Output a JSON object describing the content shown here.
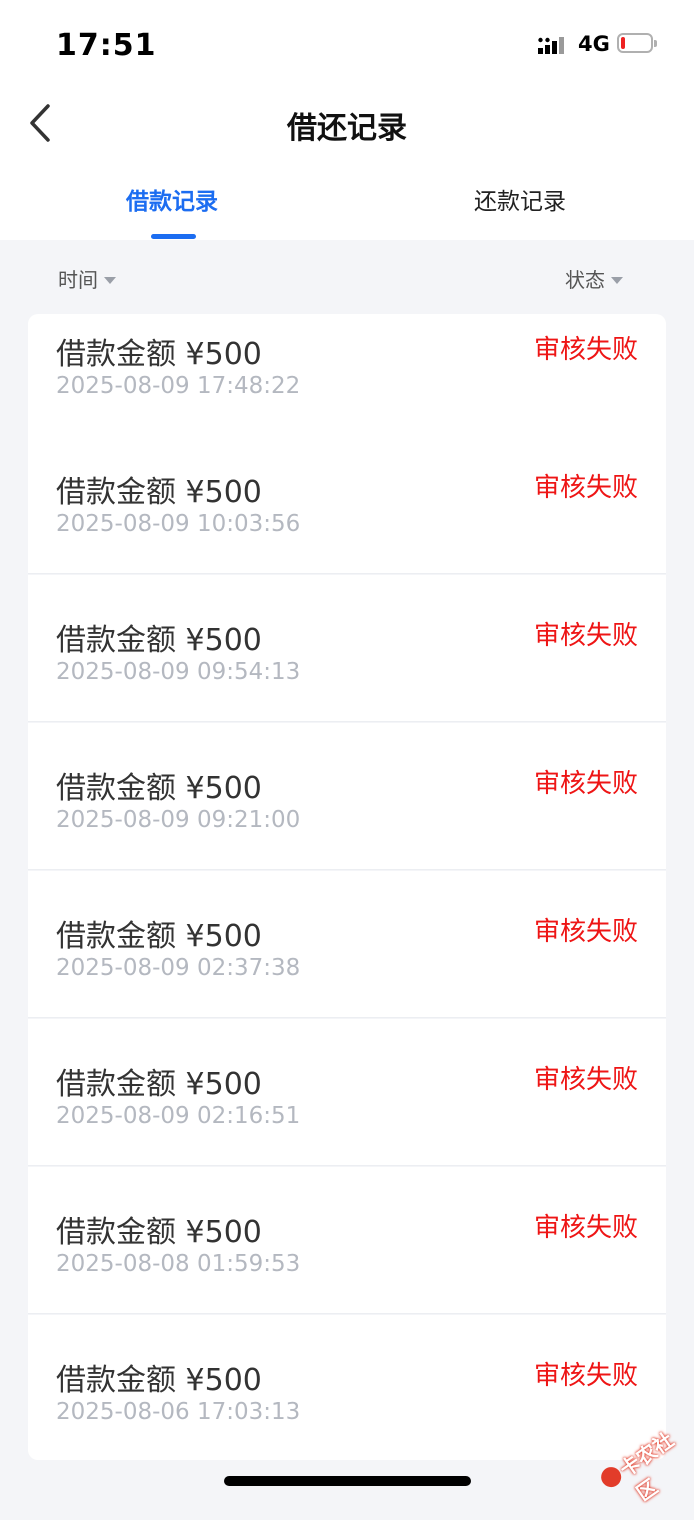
{
  "status_bar": {
    "time": "17:51",
    "network": "4G",
    "battery_level": 0.15,
    "battery_color": "#ee2222"
  },
  "nav": {
    "title": "借还记录",
    "back_icon": "chevron-left-icon"
  },
  "tabs": [
    {
      "label": "借款记录",
      "active": true
    },
    {
      "label": "还款记录",
      "active": false
    }
  ],
  "filters": {
    "time_label": "时间",
    "status_label": "状态"
  },
  "records": [
    {
      "amount": "借款金额 ¥500",
      "time": "2025-08-09 17:48:22",
      "status": "审核失败"
    },
    {
      "amount": "借款金额 ¥500",
      "time": "2025-08-09 10:03:56",
      "status": "审核失败"
    },
    {
      "amount": "借款金额 ¥500",
      "time": "2025-08-09 09:54:13",
      "status": "审核失败"
    },
    {
      "amount": "借款金额 ¥500",
      "time": "2025-08-09 09:21:00",
      "status": "审核失败"
    },
    {
      "amount": "借款金额 ¥500",
      "time": "2025-08-09 02:37:38",
      "status": "审核失败"
    },
    {
      "amount": "借款金额 ¥500",
      "time": "2025-08-09 02:16:51",
      "status": "审核失败"
    },
    {
      "amount": "借款金额 ¥500",
      "time": "2025-08-08 01:59:53",
      "status": "审核失败"
    },
    {
      "amount": "借款金额 ¥500",
      "time": "2025-08-06 17:03:13",
      "status": "审核失败"
    }
  ],
  "watermark": {
    "text": "卡农社区"
  },
  "colors": {
    "accent": "#1c6df1",
    "failed_status": "#ee1515",
    "background": "#f4f5f8"
  }
}
